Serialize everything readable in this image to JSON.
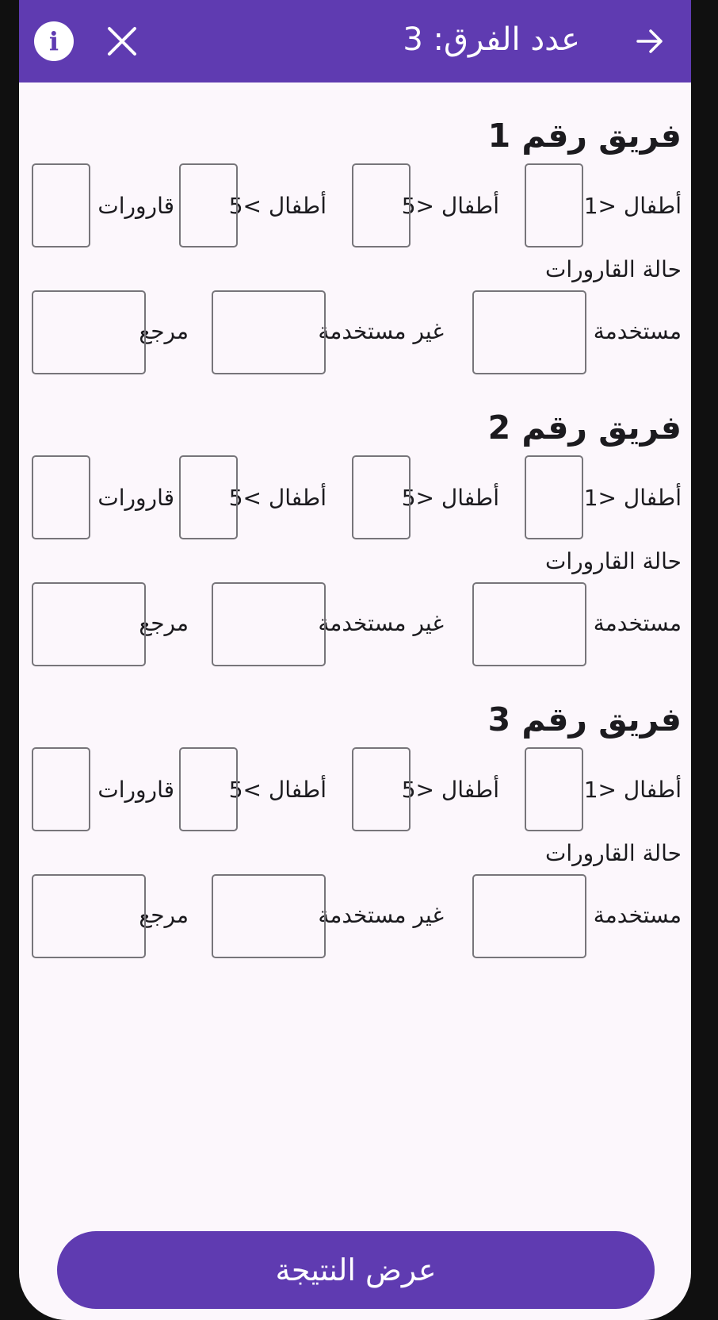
{
  "appbar": {
    "title": "عدد الفرق: 3",
    "back_icon": "arrow-right-icon",
    "close_icon": "close-icon",
    "info_icon": "info-icon",
    "info_glyph": "i"
  },
  "teams": [
    {
      "title": "فريق رقم 1",
      "labels": {
        "children_lt1": "أطفال <1",
        "children_lt5": "أطفال <5",
        "children_gt5": "أطفال >5",
        "bottles": "قارورات",
        "bottle_status": "حالة القارورات",
        "used": "مستخدمة",
        "unused": "غير مستخدمة",
        "returned": "مرجع"
      },
      "values": {
        "children_lt1": "",
        "children_lt5": "",
        "children_gt5": "",
        "bottles": "",
        "used": "",
        "unused": "",
        "returned": ""
      }
    },
    {
      "title": "فريق رقم 2",
      "labels": {
        "children_lt1": "أطفال <1",
        "children_lt5": "أطفال <5",
        "children_gt5": "أطفال >5",
        "bottles": "قارورات",
        "bottle_status": "حالة القارورات",
        "used": "مستخدمة",
        "unused": "غير مستخدمة",
        "returned": "مرجع"
      },
      "values": {
        "children_lt1": "",
        "children_lt5": "",
        "children_gt5": "",
        "bottles": "",
        "used": "",
        "unused": "",
        "returned": ""
      }
    },
    {
      "title": "فريق رقم 3",
      "labels": {
        "children_lt1": "أطفال <1",
        "children_lt5": "أطفال <5",
        "children_gt5": "أطفال >5",
        "bottles": "قارورات",
        "bottle_status": "حالة القارورات",
        "used": "مستخدمة",
        "unused": "غير مستخدمة",
        "returned": "مرجع"
      },
      "values": {
        "children_lt1": "",
        "children_lt5": "",
        "children_gt5": "",
        "bottles": "",
        "used": "",
        "unused": "",
        "returned": ""
      }
    }
  ],
  "footer": {
    "show_result_label": "عرض النتيجة"
  },
  "colors": {
    "primary": "#5f3bb1",
    "background": "#fcf7fc",
    "text": "#1c1b1f",
    "outline": "#77757a"
  }
}
